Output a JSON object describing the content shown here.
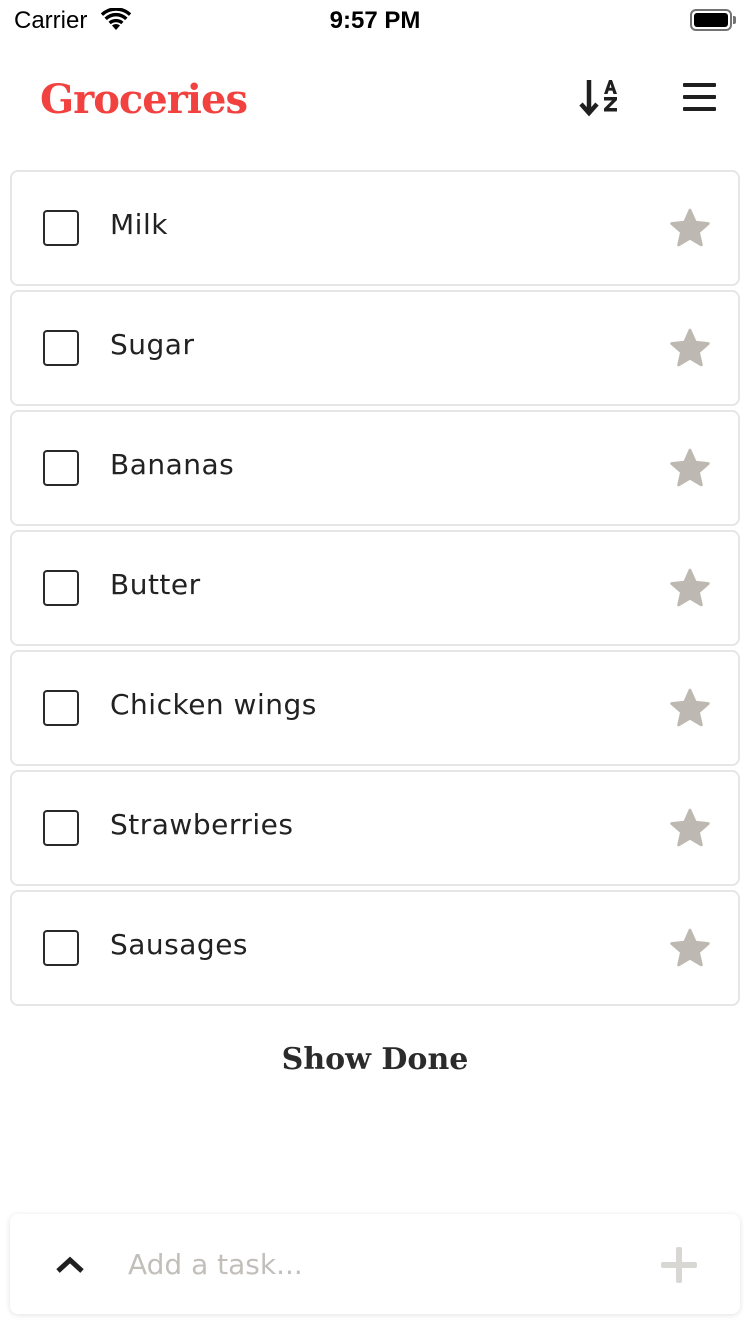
{
  "status_bar": {
    "carrier": "Carrier",
    "time": "9:57 PM"
  },
  "header": {
    "title": "Groceries",
    "sort_icon": "sort-alpha-down-icon",
    "menu_icon": "hamburger-menu-icon"
  },
  "tasks": [
    {
      "label": "Milk",
      "done": false,
      "starred": false
    },
    {
      "label": "Sugar",
      "done": false,
      "starred": false
    },
    {
      "label": "Bananas",
      "done": false,
      "starred": false
    },
    {
      "label": "Butter",
      "done": false,
      "starred": false
    },
    {
      "label": "Chicken wings",
      "done": false,
      "starred": false
    },
    {
      "label": "Strawberries",
      "done": false,
      "starred": false
    },
    {
      "label": "Sausages",
      "done": false,
      "starred": false
    }
  ],
  "show_done_label": "Show Done",
  "add_bar": {
    "placeholder": "Add a task...",
    "expand_icon": "chevron-up-icon",
    "add_icon": "plus-icon"
  },
  "colors": {
    "accent": "#f2423f",
    "star": "#bdb9b2",
    "placeholder": "#c2bfba",
    "card_border": "#e6e6e6"
  }
}
